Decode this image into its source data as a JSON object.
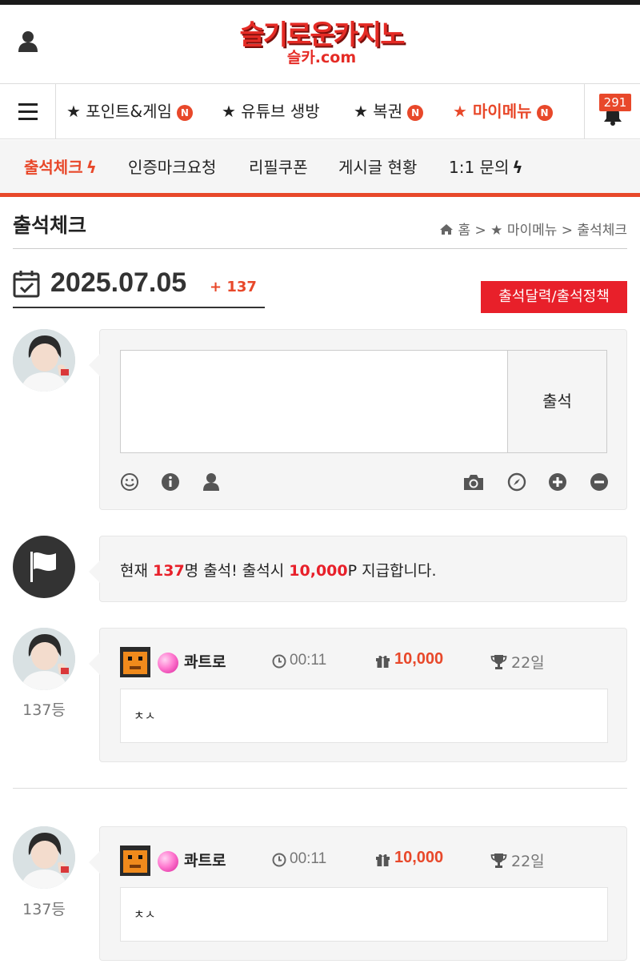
{
  "header": {
    "logo_main": "슬기로운카지노",
    "logo_sub": "슬카.com"
  },
  "nav_main": {
    "items": [
      {
        "label": "포인트&게임",
        "prefix": "★",
        "badge": "N"
      },
      {
        "label": "유튜브 생방",
        "prefix": "★",
        "badge": ""
      },
      {
        "label": "복권",
        "prefix": "★",
        "badge": "N"
      },
      {
        "label": "마이메뉴",
        "prefix": "★",
        "badge": "N"
      }
    ],
    "notification_count": "291"
  },
  "nav_sub": {
    "items": [
      "출석체크",
      "인증마크요청",
      "리필쿠폰",
      "게시글 현황",
      "1:1 문의"
    ]
  },
  "page": {
    "title": "출석체크",
    "breadcrumb": "홈 > ★ 마이메뉴 > 출석체크"
  },
  "attendance": {
    "date": "2025.07.05",
    "count_plus": "+ 137",
    "calendar_button": "출석달력/출석정책",
    "submit_label": "출석",
    "comment_value": ""
  },
  "notice": {
    "prefix": "현재 ",
    "count": "137",
    "middle": "명 출석! 출석시 ",
    "points": "10,000",
    "suffix": "P 지급합니다."
  },
  "entries": [
    {
      "rank": "137등",
      "nickname": "콰트로",
      "time": "00:11",
      "points": "10,000",
      "days": "22일",
      "comment": "ㅊㅅ"
    },
    {
      "rank": "137등",
      "nickname": "콰트로",
      "time": "00:11",
      "points": "10,000",
      "days": "22일",
      "comment": "ㅊㅅ"
    }
  ],
  "colors": {
    "accent": "#e8482a",
    "button_red": "#e8202a"
  },
  "icons": [
    "user-icon",
    "menu-icon",
    "bell-icon",
    "calendar-check-icon",
    "smile-icon",
    "info-icon",
    "user-small-icon",
    "camera-icon",
    "compass-icon",
    "plus-circle-icon",
    "minus-circle-icon",
    "flag-icon",
    "clock-icon",
    "gift-icon",
    "trophy-icon",
    "home-icon"
  ]
}
